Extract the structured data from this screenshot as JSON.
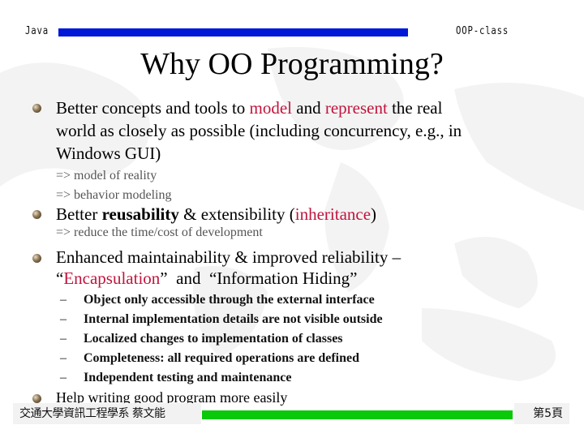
{
  "header": {
    "left_label": "Java",
    "right_label": "OOP-class",
    "bar_color": "#0018d8"
  },
  "title": "Why OO Programming?",
  "bullets": [
    {
      "lines": [
        [
          "Better concepts and tools to ",
          "model",
          " and ",
          "represent",
          " the real"
        ],
        [
          "world as closely as possible (including concurrency, e.g., in"
        ],
        [
          "Windows GUI)"
        ]
      ],
      "subs": [
        "=> model of reality",
        "=> behavior modeling"
      ]
    },
    {
      "text_a": "Better ",
      "text_bold": "reusability",
      "text_b": " & extensibility (",
      "text_red": "inheritance",
      "text_c": ")",
      "subs": [
        "=> reduce the time/cost of development"
      ]
    },
    {
      "line1": "Enhanced maintainability & improved reliability –",
      "line2_a": "“",
      "line2_red": "Encapsulation",
      "line2_b": "”  and  “Information Hiding”",
      "dash": "–",
      "items": [
        "Object only accessible through the external interface",
        "Internal implementation details are not visible outside",
        "Localized changes to implementation of classes",
        "Completeness: all required operations are defined",
        "Independent testing and maintenance"
      ]
    },
    {
      "text": "Help writing good program more easily"
    }
  ],
  "footer": {
    "left_label": "交通大學資訊工程學系 蔡文能",
    "right_label": "第5頁",
    "bar_color": "#0ac80a"
  },
  "colors": {
    "highlight": "#c0143c"
  }
}
